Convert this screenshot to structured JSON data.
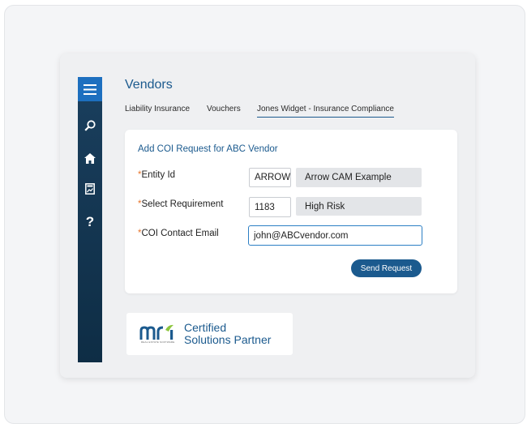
{
  "sidebar": {
    "icons": [
      "menu-icon",
      "search-icon",
      "home-icon",
      "report-icon",
      "help-icon"
    ],
    "help_glyph": "?"
  },
  "page": {
    "title": "Vendors",
    "tabs": [
      {
        "label": "Liability Insurance",
        "active": false
      },
      {
        "label": "Vouchers",
        "active": false
      },
      {
        "label": "Jones Widget - Insurance Compliance",
        "active": true
      }
    ]
  },
  "form": {
    "title": "Add COI Request for ABC Vendor",
    "required_mark": "*",
    "entity": {
      "label": "Entity Id",
      "value": "ARROW",
      "description": "Arrow CAM Example"
    },
    "requirement": {
      "label": "Select Requirement",
      "value": "1183",
      "description": "High Risk"
    },
    "email": {
      "label": "COI Contact Email",
      "value": "john@ABCvendor.com"
    },
    "submit_label": "Send Request"
  },
  "badge": {
    "logo_text": "mri",
    "logo_tagline": "REAL ESTATE SOFTWARE",
    "line1": "Certified",
    "line2": "Solutions Partner"
  },
  "colors": {
    "brand_blue": "#1b5a8e",
    "active_blue": "#1d6fbf",
    "required_orange": "#e8772e",
    "logo_green": "#8dc63f",
    "sidebar_dark": "#0e2d45"
  }
}
